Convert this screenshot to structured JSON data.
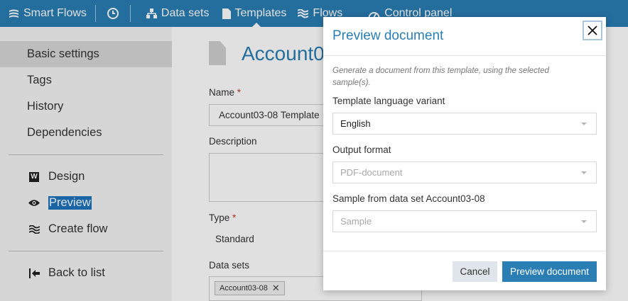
{
  "nav": {
    "brand": "Smart Flows",
    "items": [
      {
        "label": "Data sets"
      },
      {
        "label": "Templates"
      },
      {
        "label": "Flows"
      },
      {
        "label": "Control panel"
      }
    ]
  },
  "sidebar": {
    "items": [
      {
        "label": "Basic settings"
      },
      {
        "label": "Tags"
      },
      {
        "label": "History"
      },
      {
        "label": "Dependencies"
      }
    ],
    "actions": [
      {
        "label": "Design",
        "icon": "design-icon"
      },
      {
        "label": "Preview",
        "icon": "eye-icon"
      },
      {
        "label": "Create flow",
        "icon": "flow-icon"
      }
    ],
    "back": "Back to list"
  },
  "main": {
    "title": "Account0",
    "name_label": "Name",
    "name_value": "Account03-08 Template",
    "description_label": "Description",
    "type_label": "Type",
    "type_value": "Standard",
    "datasets_label": "Data sets",
    "dataset_tag": "Account03-08"
  },
  "modal": {
    "title": "Preview document",
    "hint": "Generate a document from this template, using the selected sample(s).",
    "language_label": "Template language variant",
    "language_value": "English",
    "format_label": "Output format",
    "format_placeholder": "PDF-document",
    "sample_label": "Sample from data set Account03-08",
    "sample_placeholder": "Sample",
    "cancel": "Cancel",
    "submit": "Preview document"
  }
}
